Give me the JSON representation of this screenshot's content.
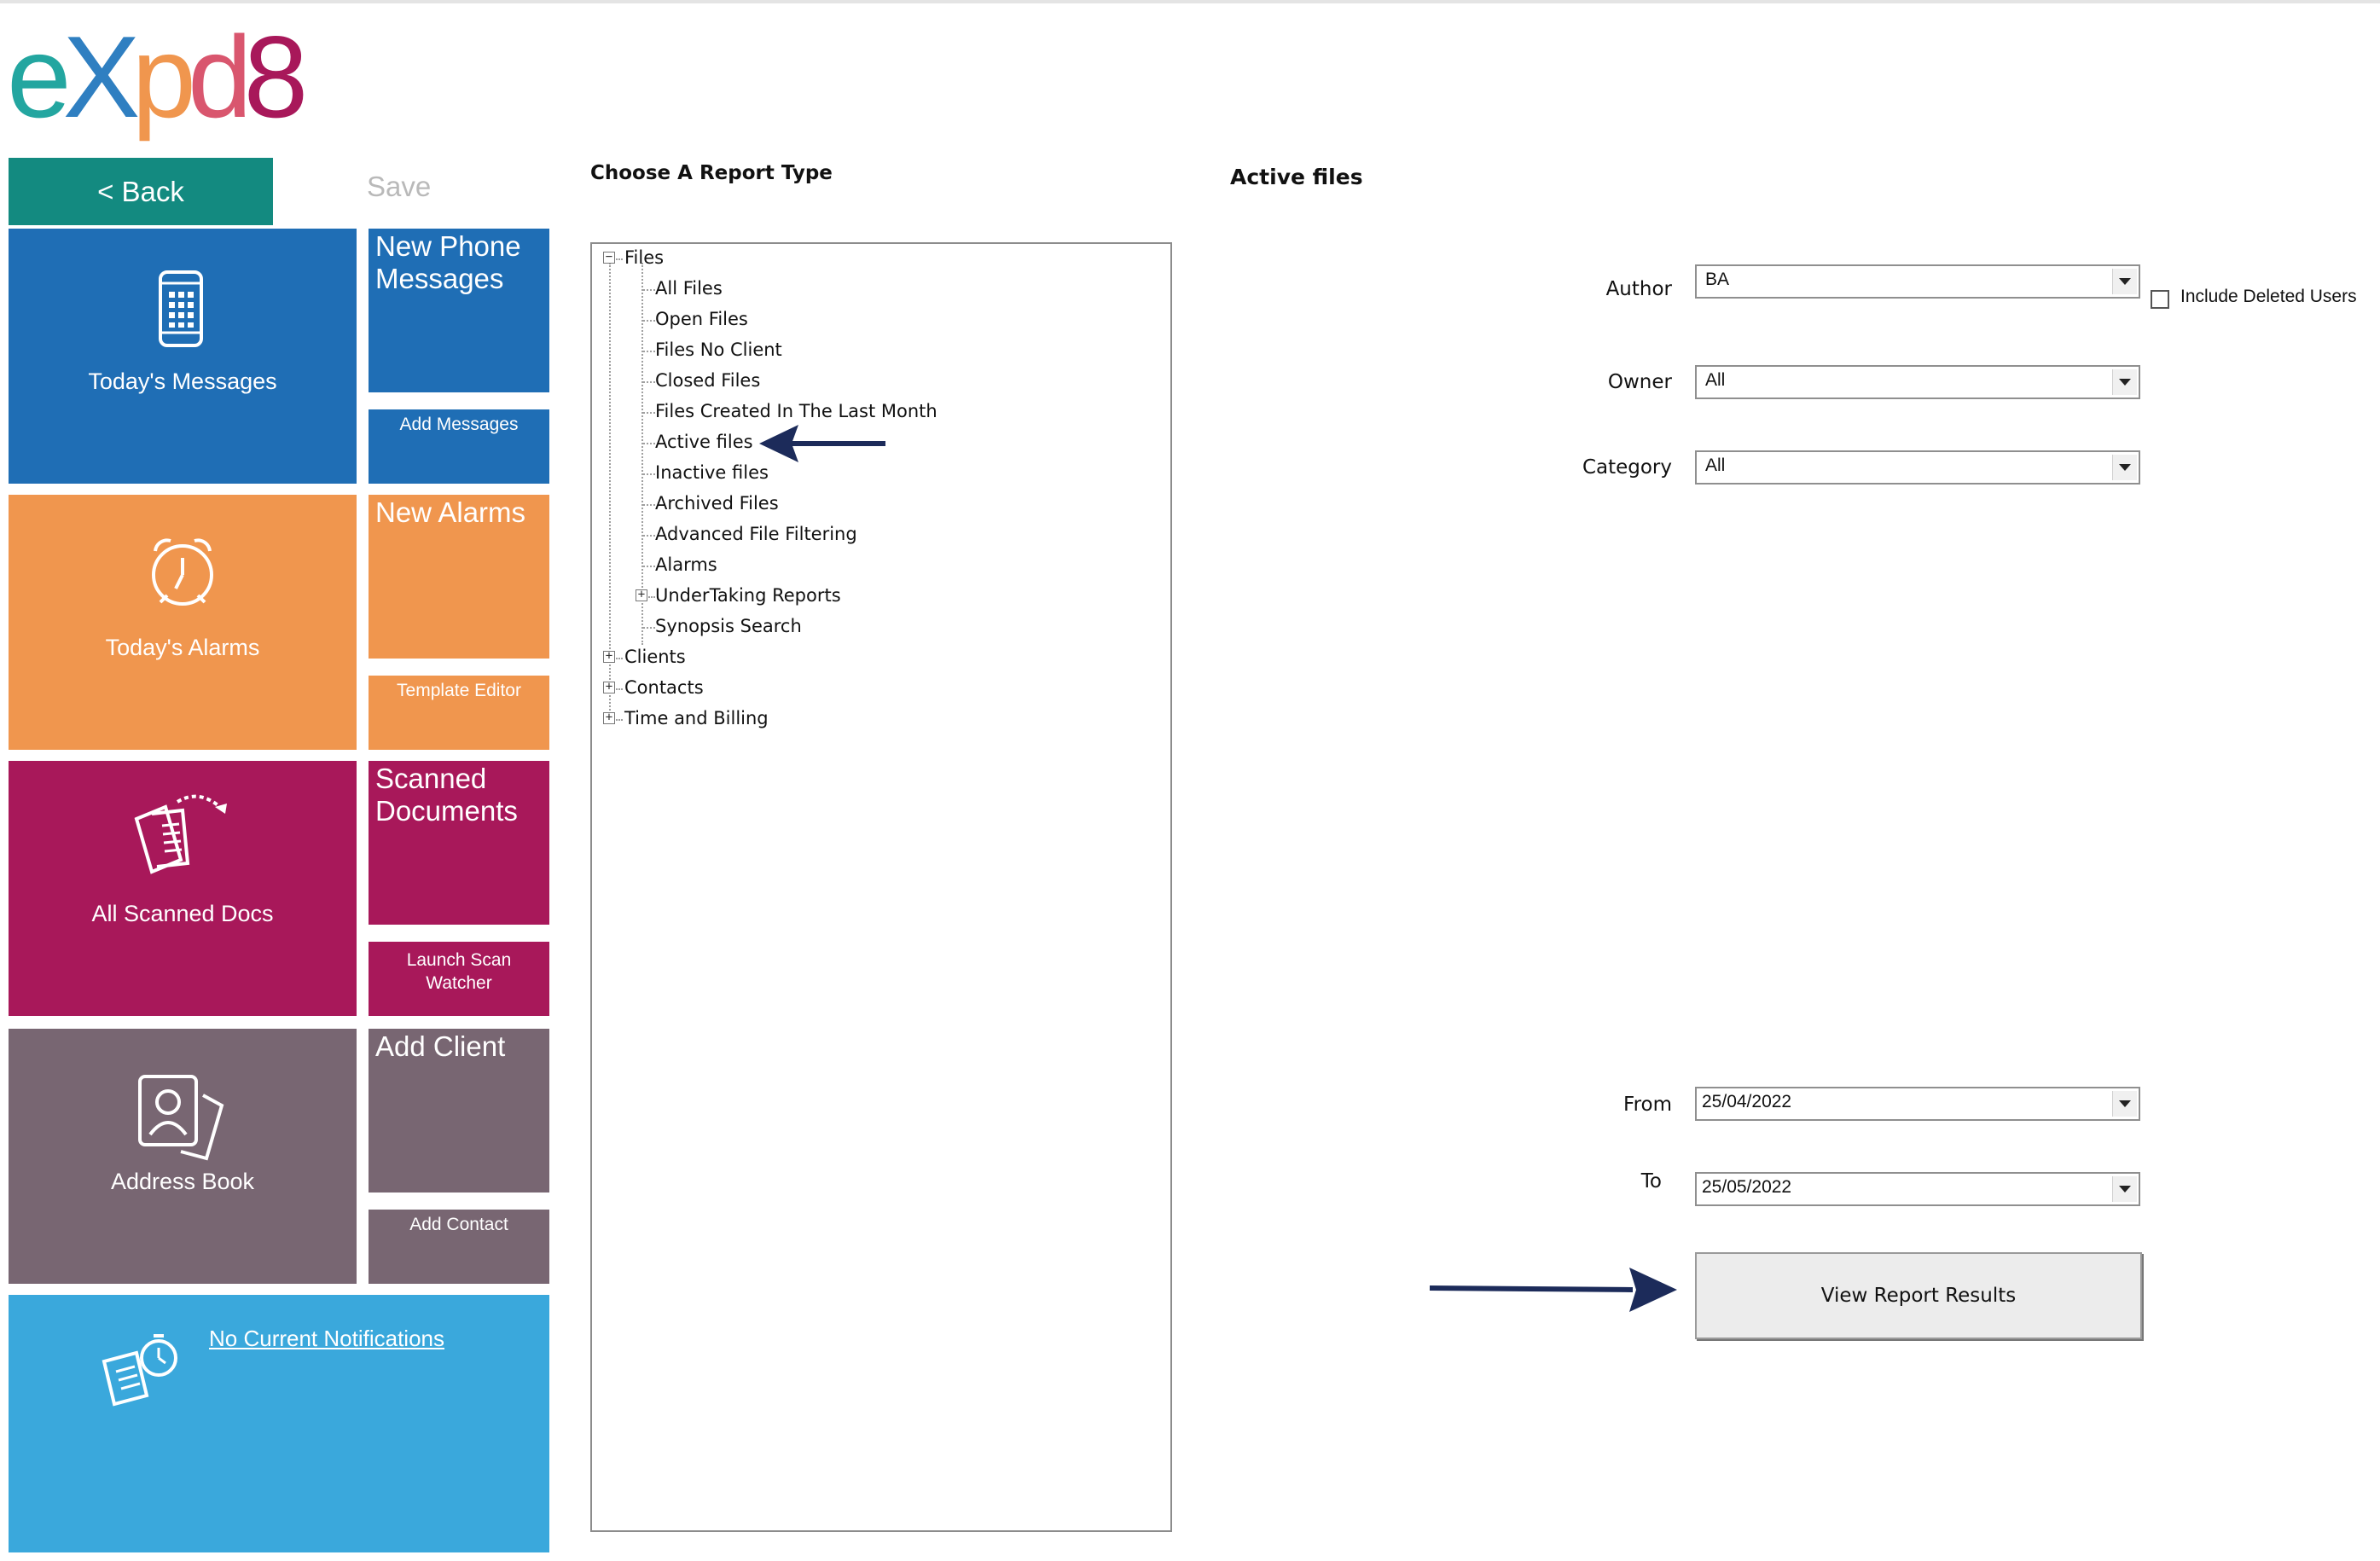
{
  "logo": {
    "text": "eXpd8"
  },
  "toolbar": {
    "back_label": "< Back",
    "save_label": "Save"
  },
  "tiles": {
    "messages": {
      "label": "Today's Messages",
      "new_title": "New Phone Messages",
      "action": "Add Messages",
      "color": "#1f6eb5",
      "icon": "phone-icon"
    },
    "alarms": {
      "label": "Today's Alarms",
      "new_title": "New Alarms",
      "action": "Template Editor",
      "color": "#f0964e",
      "icon": "alarm-clock-icon"
    },
    "scanned": {
      "label": "All Scanned Docs",
      "new_title": "Scanned Documents",
      "action": "Launch Scan Watcher",
      "color": "#a8185a",
      "icon": "documents-icon"
    },
    "address": {
      "label": "Address Book",
      "new_title": "Add Client",
      "action": "Add Contact",
      "color": "#786672",
      "icon": "contact-card-icon"
    },
    "notifications": {
      "link": "No Current Notifications",
      "color": "#3aa8dc",
      "icon": "notification-clipboard-icon"
    }
  },
  "report": {
    "choose_heading": "Choose A Report Type",
    "selected_title": "Active files",
    "tree": {
      "root": "Files",
      "children": [
        "All Files",
        "Open Files",
        "Files No Client",
        "Closed Files",
        "Files Created In The Last Month",
        "Active files",
        "Inactive files",
        "Archived Files",
        "Advanced File Filtering",
        "Alarms",
        "UnderTaking Reports",
        "Synopsis Search"
      ],
      "other_roots": [
        "Clients",
        "Contacts",
        "Time and Billing"
      ]
    }
  },
  "filters": {
    "author": {
      "label": "Author",
      "value": "BA"
    },
    "include_deleted_users": {
      "label": "Include Deleted Users",
      "checked": false
    },
    "owner": {
      "label": "Owner",
      "value": "All"
    },
    "category": {
      "label": "Category",
      "value": "All"
    },
    "from": {
      "label": "From",
      "value": "25/04/2022"
    },
    "to": {
      "label": "To",
      "value": "25/05/2022"
    }
  },
  "view_button_label": "View Report Results",
  "colors": {
    "arrow": "#1c2b5a",
    "teal": "#138a80"
  }
}
